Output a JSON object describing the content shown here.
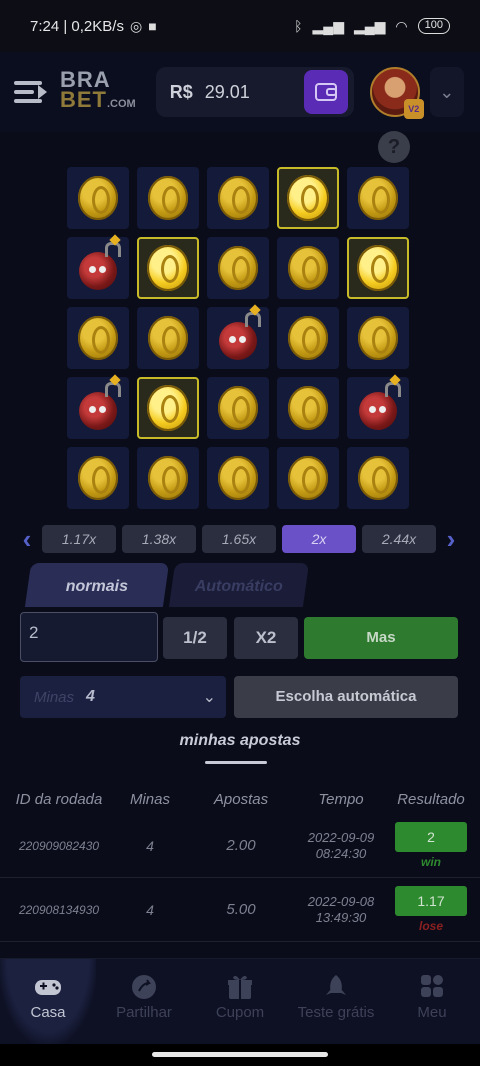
{
  "status_bar": {
    "time_net": "7:24 | 0,2KB/s",
    "battery": "100"
  },
  "header": {
    "logo_top": "BRA",
    "logo_bottom": "BET",
    "logo_com": ".COM",
    "currency": "R$",
    "balance": "29.01",
    "avatar_badge": "V2"
  },
  "help_label": "?",
  "grid": {
    "tiles": [
      "coin",
      "coin",
      "coin",
      "coin-open",
      "coin",
      "bomb",
      "coin-open",
      "coin",
      "coin",
      "coin-open",
      "coin",
      "coin",
      "bomb",
      "coin",
      "coin",
      "bomb",
      "coin-open",
      "coin",
      "coin",
      "bomb",
      "coin",
      "coin",
      "coin",
      "coin",
      "coin"
    ]
  },
  "multipliers": {
    "items": [
      "1.17x",
      "1.38x",
      "1.65x",
      "2x",
      "2.44x"
    ],
    "active_index": 3,
    "prev_label": "‹",
    "next_label": "›"
  },
  "tabs": {
    "normal": "normais",
    "auto": "Automático"
  },
  "bet": {
    "amount": "2",
    "half_label": "1/2",
    "double_label": "X2",
    "bet_label": "Mas"
  },
  "mines": {
    "label": "Minas",
    "value": "4",
    "auto_pick_label": "Escolha automática"
  },
  "my_bets": {
    "title": "minhas apostas",
    "columns": [
      "ID da rodada",
      "Minas",
      "Apostas",
      "Tempo",
      "Resultado"
    ],
    "rows": [
      {
        "id": "220909082430",
        "mines": "4",
        "amount": "2.00",
        "date": "2022-09-09",
        "time": "08:24:30",
        "result": "2",
        "outcome": "win"
      },
      {
        "id": "220908134930",
        "mines": "4",
        "amount": "5.00",
        "date": "2022-09-08",
        "time": "13:49:30",
        "result": "1.17",
        "outcome": "lose"
      }
    ]
  },
  "bottom_nav": {
    "items": [
      {
        "label": "Casa",
        "icon": "gamepad-icon",
        "active": true
      },
      {
        "label": "Partilhar",
        "icon": "share-icon",
        "active": false
      },
      {
        "label": "Cupom",
        "icon": "gift-icon",
        "active": false
      },
      {
        "label": "Teste grátis",
        "icon": "rocket-icon",
        "active": false
      },
      {
        "label": "Meu",
        "icon": "apps-icon",
        "active": false
      }
    ]
  },
  "colors": {
    "accent_purple": "#6b51c8",
    "bet_green": "#2e7a2e",
    "win_green": "#2e8a2e",
    "lose_red": "#8a2020",
    "highlight_yellow": "#c8bb2a"
  }
}
